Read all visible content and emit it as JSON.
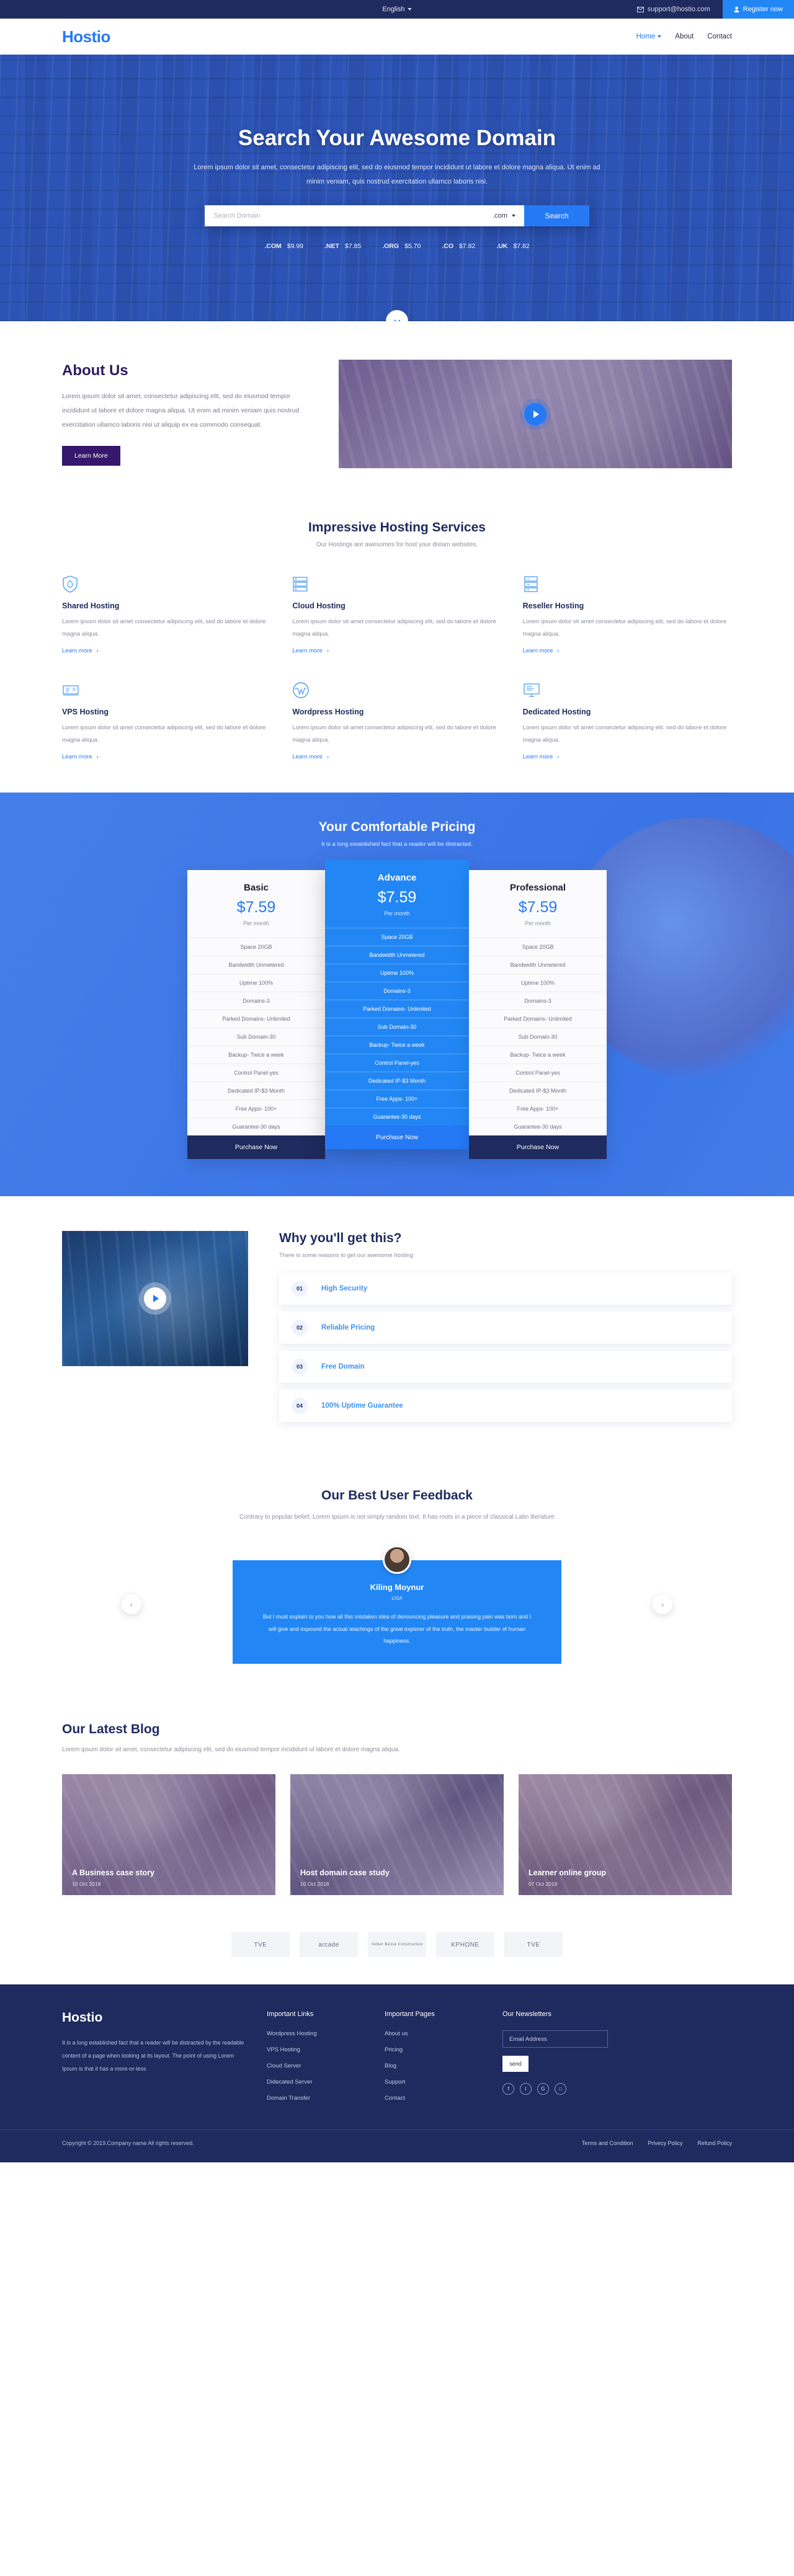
{
  "topbar": {
    "language": "English",
    "email": "support@hostio.com",
    "register": "Register now"
  },
  "nav": {
    "logo": "Hostio",
    "links": [
      {
        "label": "Home",
        "active": true,
        "dropdown": true
      },
      {
        "label": "About",
        "active": false,
        "dropdown": false
      },
      {
        "label": "Contact",
        "active": false,
        "dropdown": false
      }
    ]
  },
  "hero": {
    "title": "Search Your Awesome Domain",
    "subtitle": "Lorem ipsum dolor sit amet, consectetur adipiscing elit, sed do eiusmod tempor incididunt ut labore et dolore magna aliqua. Ut enim ad minim veniam, quis nostrud exercitation ullamco laboris nisi.",
    "search_placeholder": "Search Domain",
    "search_value": "",
    "tld_selected": ".com",
    "search_button": "Search",
    "tlds": [
      {
        "ext": ".COM",
        "price": "$9.99"
      },
      {
        "ext": ".NET",
        "price": "$7.85"
      },
      {
        "ext": ".ORG",
        "price": "$5.70"
      },
      {
        "ext": ".CO",
        "price": "$7.82"
      },
      {
        "ext": ".UK",
        "price": "$7.82"
      }
    ]
  },
  "about": {
    "title": "About Us",
    "body": "Lorem ipsum dolor sit amet, consectetur adipiscing elit, sed do eiusmod tempor incididunt ut labore et dolore magna aliqua. Ut enim ad minim veniam quis nostrud exercitation ullamco laboris nisi ut aliquip ex ea commodo consequat.",
    "button": "Learn More"
  },
  "services": {
    "title": "Impressive Hosting Services",
    "subtitle": "Our Hostings are awesomes for host your dream websites.",
    "learn_more": "Learn more",
    "items": [
      {
        "icon": "shield-flame-icon",
        "title": "Shared Hosting",
        "desc": "Lorem ipsum dolor sit amet consectetur adipiscing elit, sed do labore et dolore magna aliqua."
      },
      {
        "icon": "server-rack-icon",
        "title": "Cloud Hosting",
        "desc": "Lorem ipsum dolor sit amet consectetur adipiscing elit, sed do labore et dolore magna aliqua."
      },
      {
        "icon": "server-stack-icon",
        "title": "Reseller Hosting",
        "desc": "Lorem ipsum dolor sit amet consectetur adipiscing elit, sed do labore et dolore magna aliqua."
      },
      {
        "icon": "vps-icon",
        "title": "VPS Hosting",
        "desc": "Lorem ipsum dolor sit amet consectetur adipiscing elit, sed do labore et dolore magna aliqua."
      },
      {
        "icon": "wordpress-icon",
        "title": "Wordpress Hosting",
        "desc": "Lorem ipsum dolor sit amet consectetur adipiscing elit, sed do labore et dolore magna aliqua."
      },
      {
        "icon": "monitor-icon",
        "title": "Dedicated Hosting",
        "desc": "Lorem ipsum dolor sit amet consectetur adipiscing elit, sed do labore et dolore magna aliqua."
      }
    ]
  },
  "pricing": {
    "title": "Your Comfortable Pricing",
    "subtitle": "It is a long established fact that a reader will be distracted.",
    "per_month": "Per month",
    "purchase": "Purchase Now",
    "plans": [
      {
        "name": "Basic",
        "price": "$7.59",
        "featured": false,
        "features": [
          "Space 20GB",
          "Bandwidth Unmetered",
          "Uptime 100%",
          "Domains-3",
          "Parked Domains- Unlimited",
          "Sub Domain-30",
          "Backup- Twice a week",
          "Control Panel-yes",
          "Dedicated IP-$3 Month",
          "Free Apps- 100+",
          "Guarantee-30 days"
        ]
      },
      {
        "name": "Advance",
        "price": "$7.59",
        "featured": true,
        "features": [
          "Space 20GB",
          "Bandwidth Unmetered",
          "Uptime 100%",
          "Domains-3",
          "Parked Domains- Unlimited",
          "Sub Domain-30",
          "Backup- Twice a week",
          "Control Panel-yes",
          "Dedicated IP-$3 Month",
          "Free Apps- 100+",
          "Guarantee-30 days"
        ]
      },
      {
        "name": "Professional",
        "price": "$7.59",
        "featured": false,
        "features": [
          "Space 20GB",
          "Bandwidth Unmetered",
          "Uptime 100%",
          "Domains-3",
          "Parked Domains- Unlimited",
          "Sub Domain-30",
          "Backup- Twice a week",
          "Control Panel-yes",
          "Dedicated IP-$3 Month",
          "Free Apps- 100+",
          "Guarantee-30 days"
        ]
      }
    ]
  },
  "why": {
    "title": "Why you'll get this?",
    "subtitle": "There is some reasons to get our awesome hosting",
    "items": [
      {
        "num": "01",
        "label": "High Security"
      },
      {
        "num": "02",
        "label": "Reliable Pricing"
      },
      {
        "num": "03",
        "label": "Free Domain"
      },
      {
        "num": "04",
        "label": "100% Uptime Guarantee"
      }
    ]
  },
  "feedback": {
    "title": "Our Best User Feedback",
    "subtitle": "Contrary to popular belief, Lorem Ipsum is not simply random text. It has roots in a piece of classical Latin literature",
    "name": "Kiling Moynur",
    "country": "USA",
    "quote": "But I must explain to you how all this mistaken idea of denouncing pleasure and praising pain was born and I will give and expound the actual teachings of the great explorer of the truth, the master builder of human happiness.",
    "prev": "‹",
    "next": "›"
  },
  "blog": {
    "title": "Our Latest Blog",
    "subtitle": "Lorem ipsum dolor sit amet, consectetur adipiscing elit, sed do eiusmod tempor incididunt ut labore et dolore magna aliqua.",
    "posts": [
      {
        "title": "A Business case story",
        "date": "10 Oct 2018"
      },
      {
        "title": "Host domain case study",
        "date": "10 Oct 2018"
      },
      {
        "title": "Learner online group",
        "date": "07 Oct 2018"
      }
    ]
  },
  "brands": [
    {
      "name": "TVE"
    },
    {
      "name": "arcade"
    },
    {
      "name": "Volker Besse Construction"
    },
    {
      "name": "KPHONE"
    },
    {
      "name": "TVE"
    }
  ],
  "footer": {
    "logo": "Hostio",
    "about": "It is a long established fact that a reader will be distracted by the readable content of a page when looking at its layout. The point of using Lorem Ipsum is that it has a more-or-less",
    "links_title": "Important Links",
    "links": [
      "Wordpress Hosting",
      "VPS Hosting",
      "Cloud Server",
      "Didecated Server",
      "Domain Transfer"
    ],
    "pages_title": "Important Pages",
    "pages": [
      "About us",
      "Pricing",
      "Blog",
      "Support",
      "Contact"
    ],
    "news_title": "Our Newsletters",
    "news_placeholder": "Email Address",
    "news_value": "",
    "send": "send",
    "socials": [
      {
        "icon": "facebook-icon",
        "glyph": "f"
      },
      {
        "icon": "twitter-icon",
        "glyph": "t"
      },
      {
        "icon": "google-icon",
        "glyph": "G"
      },
      {
        "icon": "instagram-icon",
        "glyph": "□"
      }
    ],
    "copyright": "Copyright © 2019.Company name All rights reserved.",
    "legal": [
      "Terms and Condition",
      "Privecy Policy",
      "Refund Policy"
    ]
  }
}
